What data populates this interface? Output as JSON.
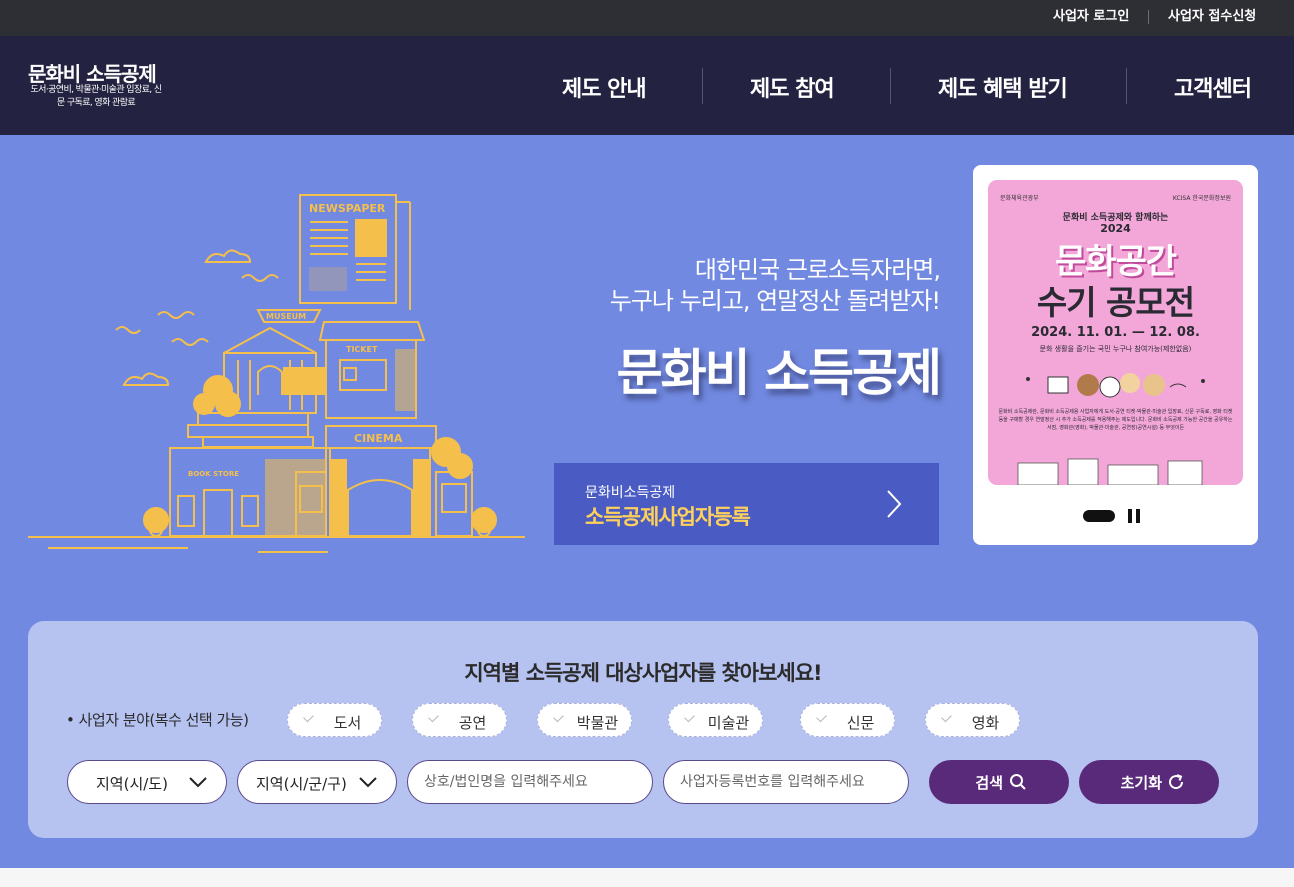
{
  "topbar": {
    "login": "사업자 로그인",
    "apply": "사업자 접수신청"
  },
  "logo": {
    "title": "문화비 소득공제",
    "subtitle": "도서·공연비, 박물관·미술관 입장료, 신문 구독료, 영화 관람료"
  },
  "nav": {
    "items": [
      "제도 안내",
      "제도 참여",
      "제도 혜택 받기",
      "고객센터"
    ]
  },
  "hero": {
    "slogan_line1": "대한민국 근로소득자라면,",
    "slogan_line2": "누구나 누리고, 연말정산 돌려받자!",
    "title": "문화비 소득공제",
    "illustration_labels": {
      "newspaper": "NEWSPAPER",
      "museum": "MUSEUM",
      "ticket": "TICKET",
      "cinema": "CINEMA",
      "bookstore": "BOOK STORE"
    },
    "register": {
      "small": "문화비소득공제",
      "big": "소득공제사업자등록"
    }
  },
  "banner": {
    "org_left": "문화체육관광부",
    "org_right": "KCISA 한국문화정보원",
    "arc_text": "문화비 소득공제와 함께하는",
    "year": "2024",
    "title_line1": "문화공간",
    "title_line2": "수기 공모전",
    "date": "2024. 11. 01. — 12. 08.",
    "tagline": "문화 생활을 즐기는 국민 누구나 참여가능(제한없음)",
    "description": "문화비 소득공제란, 문화비 소득공제용 사업자에게 도서·공연 티켓·박물관·미술관 입장료, 신문 구독료, 영화 티켓 등을 구매할 경우 연말정산 시 추가 소득공제를 적용해주는 제도입니다. 문화비 소득공제 가능한 공간을 공유하는 서점, 영화관(영화), 박물관·미술관, 공연장(공연시설) 등 무엇이든",
    "total_slides": 2
  },
  "search": {
    "title": "지역별 소득공제 대상사업자를 찾아보세요!",
    "label": "• 사업자 분야(복수 선택 가능)",
    "categories": [
      "도서",
      "공연",
      "박물관",
      "미술관",
      "신문",
      "영화"
    ],
    "region_sido": "지역(시/도)",
    "region_sigungu": "지역(시/군/구)",
    "name_placeholder": "상호/법인명을 입력해주세요",
    "bizno_placeholder": "사업자등록번호를 입력해주세요",
    "search_label": "검색",
    "reset_label": "초기화"
  },
  "colors": {
    "topbar": "#2e2e35",
    "gnb": "#232240",
    "hero": "#7189e0",
    "accent_yellow": "#ffd15a",
    "button_purple": "#5a2a7a",
    "search_panel": "#b6c2f0"
  }
}
